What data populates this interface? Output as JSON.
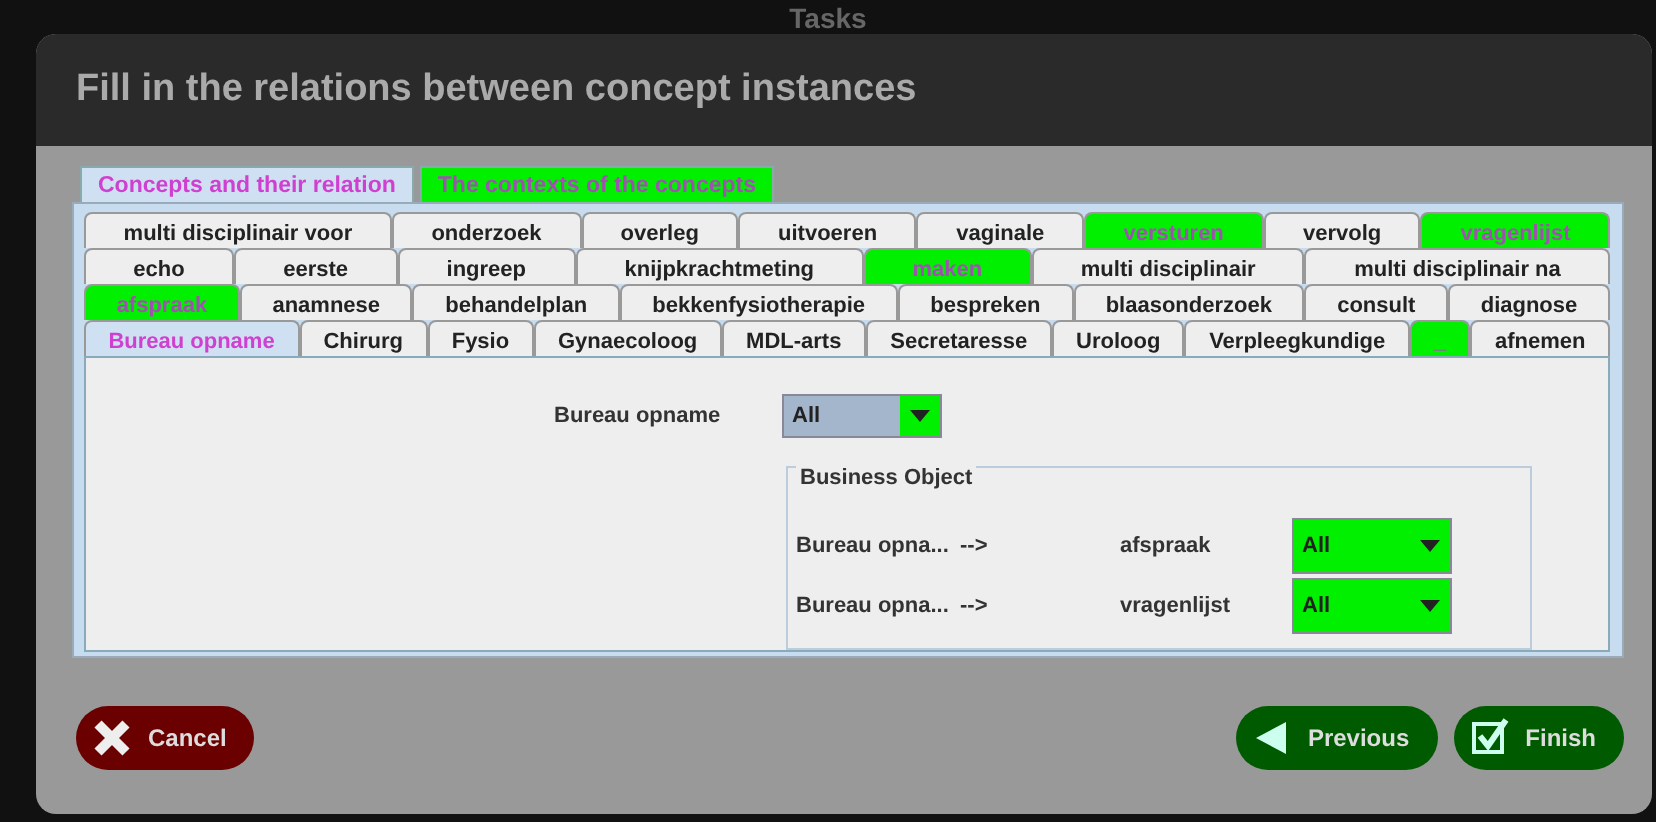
{
  "backdrop_title": "Tasks",
  "window": {
    "title": "Fill in the relations between concept instances"
  },
  "outer_tabs": [
    {
      "label": "Concepts and their relation",
      "selected": true,
      "highlighted": false
    },
    {
      "label": "The contexts of the concepts",
      "selected": false,
      "highlighted": true
    }
  ],
  "concept_tab_rows": [
    {
      "tabs": [
        {
          "label": "multi disciplinair voor",
          "selected": false,
          "highlighted": false
        },
        {
          "label": "onderzoek",
          "selected": false,
          "highlighted": false
        },
        {
          "label": "overleg",
          "selected": false,
          "highlighted": false
        },
        {
          "label": "uitvoeren",
          "selected": false,
          "highlighted": false
        },
        {
          "label": "vaginale",
          "selected": false,
          "highlighted": false
        },
        {
          "label": "versturen",
          "selected": false,
          "highlighted": true
        },
        {
          "label": "vervolg",
          "selected": false,
          "highlighted": false
        },
        {
          "label": "vragenlijst",
          "selected": false,
          "highlighted": true
        }
      ]
    },
    {
      "tabs": [
        {
          "label": "echo",
          "selected": false,
          "highlighted": false
        },
        {
          "label": "eerste",
          "selected": false,
          "highlighted": false
        },
        {
          "label": "ingreep",
          "selected": false,
          "highlighted": false
        },
        {
          "label": "knijpkrachtmeting",
          "selected": false,
          "highlighted": false
        },
        {
          "label": "maken",
          "selected": false,
          "highlighted": true
        },
        {
          "label": "multi disciplinair",
          "selected": false,
          "highlighted": false
        },
        {
          "label": "multi disciplinair na",
          "selected": false,
          "highlighted": false
        }
      ]
    },
    {
      "tabs": [
        {
          "label": "afspraak",
          "selected": false,
          "highlighted": true
        },
        {
          "label": "anamnese",
          "selected": false,
          "highlighted": false
        },
        {
          "label": "behandelplan",
          "selected": false,
          "highlighted": false
        },
        {
          "label": "bekkenfysiotherapie",
          "selected": false,
          "highlighted": false
        },
        {
          "label": "bespreken",
          "selected": false,
          "highlighted": false
        },
        {
          "label": "blaasonderzoek",
          "selected": false,
          "highlighted": false
        },
        {
          "label": "consult",
          "selected": false,
          "highlighted": false
        },
        {
          "label": "diagnose",
          "selected": false,
          "highlighted": false
        }
      ]
    },
    {
      "tabs": [
        {
          "label": "Bureau opname",
          "selected": true,
          "highlighted": false
        },
        {
          "label": "Chirurg",
          "selected": false,
          "highlighted": false
        },
        {
          "label": "Fysio",
          "selected": false,
          "highlighted": false
        },
        {
          "label": "Gynaecoloog",
          "selected": false,
          "highlighted": false
        },
        {
          "label": "MDL-arts",
          "selected": false,
          "highlighted": false
        },
        {
          "label": "Secretaresse",
          "selected": false,
          "highlighted": false
        },
        {
          "label": "Uroloog",
          "selected": false,
          "highlighted": false
        },
        {
          "label": "Verpleegkundige",
          "selected": false,
          "highlighted": false
        },
        {
          "label": "_",
          "selected": false,
          "highlighted": true
        },
        {
          "label": "afnemen",
          "selected": false,
          "highlighted": false
        }
      ]
    }
  ],
  "filter": {
    "label": "Bureau opname",
    "value": "All",
    "highlighted": false
  },
  "business_object": {
    "title": "Business Object",
    "rows": [
      {
        "source": "Bureau opna...",
        "arrow": "-->",
        "target": "afspraak",
        "value": "All",
        "highlighted": true
      },
      {
        "source": "Bureau opna...",
        "arrow": "-->",
        "target": "vragenlijst",
        "value": "All",
        "highlighted": true
      }
    ]
  },
  "buttons": [
    {
      "label": "Cancel",
      "kind": "cancel"
    },
    {
      "label": "Previous",
      "kind": "previous"
    },
    {
      "label": "Finish",
      "kind": "finish"
    }
  ]
}
